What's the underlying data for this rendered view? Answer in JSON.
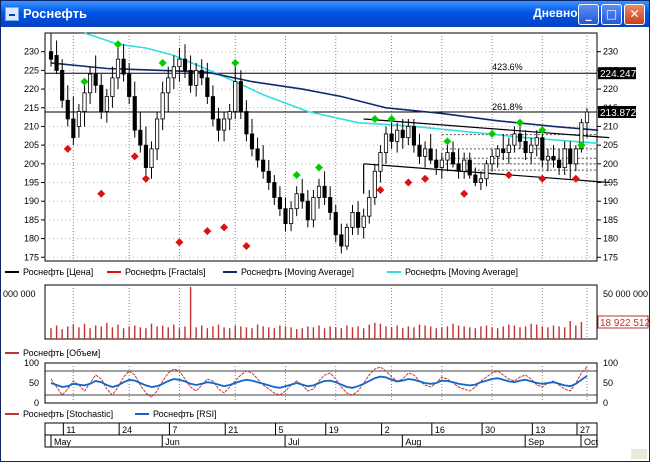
{
  "window": {
    "title": "Роснефть",
    "timeframe": "Дневной",
    "buttons": {
      "minimize": "_",
      "maximize": "□",
      "close": "✕"
    }
  },
  "colors": {
    "candle": "#000000",
    "fractal_up": "#00cc00",
    "fractal_down": "#dd1111",
    "ma_slow": "#102a6b",
    "ma_fast": "#33dddd",
    "volume": "#c23030",
    "stochastic": "#cc3333",
    "rsi": "#1166cc"
  },
  "chart_data": [
    {
      "type": "candlestick",
      "panel": "price",
      "ylim": [
        174,
        235
      ],
      "yticks": [
        175,
        180,
        185,
        190,
        195,
        200,
        205,
        210,
        215,
        220,
        225,
        230
      ],
      "price_labels": {
        "fib_level": "224.247",
        "last": "213.872"
      },
      "fib_annotations": [
        "423.6%",
        "261.8%"
      ],
      "legend": [
        "Роснефть [Цена]",
        "Роснефть [Fractals]",
        "Роснефть [Moving Average]",
        "Роснефть [Moving Average]"
      ],
      "candles": [
        {
          "o": 230,
          "h": 235,
          "l": 226,
          "c": 228
        },
        {
          "o": 229,
          "h": 233,
          "l": 224,
          "c": 225
        },
        {
          "o": 225,
          "h": 228,
          "l": 215,
          "c": 217
        },
        {
          "o": 217,
          "h": 221,
          "l": 210,
          "c": 212
        },
        {
          "o": 212,
          "h": 218,
          "l": 205,
          "c": 207
        },
        {
          "o": 210,
          "h": 216,
          "l": 207,
          "c": 214
        },
        {
          "o": 214,
          "h": 221,
          "l": 210,
          "c": 219
        },
        {
          "o": 219,
          "h": 226,
          "l": 216,
          "c": 224
        },
        {
          "o": 224,
          "h": 229,
          "l": 219,
          "c": 221
        },
        {
          "o": 221,
          "h": 224,
          "l": 212,
          "c": 214
        },
        {
          "o": 214,
          "h": 220,
          "l": 211,
          "c": 218
        },
        {
          "o": 218,
          "h": 226,
          "l": 215,
          "c": 223
        },
        {
          "o": 223,
          "h": 231,
          "l": 220,
          "c": 228
        },
        {
          "o": 228,
          "h": 232,
          "l": 222,
          "c": 224
        },
        {
          "o": 224,
          "h": 227,
          "l": 216,
          "c": 218
        },
        {
          "o": 218,
          "h": 222,
          "l": 207,
          "c": 209
        },
        {
          "o": 209,
          "h": 214,
          "l": 203,
          "c": 205
        },
        {
          "o": 205,
          "h": 210,
          "l": 197,
          "c": 199
        },
        {
          "o": 199,
          "h": 206,
          "l": 196,
          "c": 204
        },
        {
          "o": 204,
          "h": 214,
          "l": 201,
          "c": 212
        },
        {
          "o": 212,
          "h": 222,
          "l": 209,
          "c": 219
        },
        {
          "o": 219,
          "h": 226,
          "l": 214,
          "c": 223
        },
        {
          "o": 223,
          "h": 229,
          "l": 220,
          "c": 226
        },
        {
          "o": 226,
          "h": 231,
          "l": 222,
          "c": 228
        },
        {
          "o": 228,
          "h": 232,
          "l": 223,
          "c": 225
        },
        {
          "o": 225,
          "h": 229,
          "l": 219,
          "c": 221
        },
        {
          "o": 221,
          "h": 227,
          "l": 218,
          "c": 225
        },
        {
          "o": 225,
          "h": 228,
          "l": 221,
          "c": 223
        },
        {
          "o": 223,
          "h": 227,
          "l": 216,
          "c": 218
        },
        {
          "o": 218,
          "h": 221,
          "l": 210,
          "c": 212
        },
        {
          "o": 212,
          "h": 215,
          "l": 206,
          "c": 209
        },
        {
          "o": 209,
          "h": 214,
          "l": 206,
          "c": 212
        },
        {
          "o": 212,
          "h": 216,
          "l": 209,
          "c": 214
        },
        {
          "o": 214,
          "h": 226,
          "l": 212,
          "c": 222
        },
        {
          "o": 222,
          "h": 225,
          "l": 212,
          "c": 214
        },
        {
          "o": 214,
          "h": 217,
          "l": 206,
          "c": 208
        },
        {
          "o": 208,
          "h": 212,
          "l": 202,
          "c": 204
        },
        {
          "o": 204,
          "h": 207,
          "l": 199,
          "c": 201
        },
        {
          "o": 201,
          "h": 205,
          "l": 196,
          "c": 198
        },
        {
          "o": 198,
          "h": 201,
          "l": 193,
          "c": 195
        },
        {
          "o": 195,
          "h": 197,
          "l": 189,
          "c": 191
        },
        {
          "o": 191,
          "h": 194,
          "l": 186,
          "c": 188
        },
        {
          "o": 188,
          "h": 191,
          "l": 182,
          "c": 184
        },
        {
          "o": 184,
          "h": 190,
          "l": 182,
          "c": 188
        },
        {
          "o": 188,
          "h": 194,
          "l": 186,
          "c": 192
        },
        {
          "o": 192,
          "h": 196,
          "l": 188,
          "c": 190
        },
        {
          "o": 190,
          "h": 193,
          "l": 183,
          "c": 185
        },
        {
          "o": 185,
          "h": 193,
          "l": 183,
          "c": 191
        },
        {
          "o": 191,
          "h": 196,
          "l": 188,
          "c": 194
        },
        {
          "o": 194,
          "h": 198,
          "l": 189,
          "c": 191
        },
        {
          "o": 191,
          "h": 194,
          "l": 185,
          "c": 187
        },
        {
          "o": 187,
          "h": 189,
          "l": 179,
          "c": 181
        },
        {
          "o": 181,
          "h": 184,
          "l": 176,
          "c": 178
        },
        {
          "o": 178,
          "h": 184,
          "l": 177,
          "c": 183
        },
        {
          "o": 183,
          "h": 189,
          "l": 181,
          "c": 187
        },
        {
          "o": 187,
          "h": 190,
          "l": 181,
          "c": 183
        },
        {
          "o": 183,
          "h": 188,
          "l": 180,
          "c": 186
        },
        {
          "o": 186,
          "h": 193,
          "l": 184,
          "c": 191
        },
        {
          "o": 191,
          "h": 200,
          "l": 189,
          "c": 198
        },
        {
          "o": 198,
          "h": 205,
          "l": 195,
          "c": 203
        },
        {
          "o": 203,
          "h": 210,
          "l": 200,
          "c": 208
        },
        {
          "o": 208,
          "h": 212,
          "l": 204,
          "c": 206
        },
        {
          "o": 206,
          "h": 211,
          "l": 203,
          "c": 209
        },
        {
          "o": 209,
          "h": 212,
          "l": 204,
          "c": 207
        },
        {
          "o": 207,
          "h": 212,
          "l": 205,
          "c": 210
        },
        {
          "o": 210,
          "h": 212,
          "l": 203,
          "c": 205
        },
        {
          "o": 205,
          "h": 208,
          "l": 200,
          "c": 202
        },
        {
          "o": 202,
          "h": 206,
          "l": 199,
          "c": 204
        },
        {
          "o": 204,
          "h": 208,
          "l": 200,
          "c": 201
        },
        {
          "o": 201,
          "h": 204,
          "l": 197,
          "c": 199
        },
        {
          "o": 199,
          "h": 203,
          "l": 196,
          "c": 201
        },
        {
          "o": 201,
          "h": 205,
          "l": 198,
          "c": 203
        },
        {
          "o": 203,
          "h": 206,
          "l": 199,
          "c": 200
        },
        {
          "o": 200,
          "h": 204,
          "l": 196,
          "c": 198
        },
        {
          "o": 198,
          "h": 203,
          "l": 196,
          "c": 201
        },
        {
          "o": 201,
          "h": 203,
          "l": 196,
          "c": 197
        },
        {
          "o": 197,
          "h": 199,
          "l": 194,
          "c": 195
        },
        {
          "o": 195,
          "h": 198,
          "l": 193,
          "c": 196
        },
        {
          "o": 196,
          "h": 201,
          "l": 194,
          "c": 200
        },
        {
          "o": 200,
          "h": 204,
          "l": 198,
          "c": 202
        },
        {
          "o": 202,
          "h": 205,
          "l": 199,
          "c": 204
        },
        {
          "o": 204,
          "h": 208,
          "l": 201,
          "c": 203
        },
        {
          "o": 203,
          "h": 207,
          "l": 200,
          "c": 205
        },
        {
          "o": 205,
          "h": 210,
          "l": 203,
          "c": 208
        },
        {
          "o": 208,
          "h": 211,
          "l": 204,
          "c": 206
        },
        {
          "o": 206,
          "h": 209,
          "l": 201,
          "c": 203
        },
        {
          "o": 203,
          "h": 207,
          "l": 200,
          "c": 205
        },
        {
          "o": 205,
          "h": 209,
          "l": 202,
          "c": 207
        },
        {
          "o": 207,
          "h": 208,
          "l": 199,
          "c": 201
        },
        {
          "o": 201,
          "h": 204,
          "l": 198,
          "c": 202
        },
        {
          "o": 202,
          "h": 205,
          "l": 199,
          "c": 201
        },
        {
          "o": 201,
          "h": 204,
          "l": 197,
          "c": 199
        },
        {
          "o": 199,
          "h": 206,
          "l": 197,
          "c": 204
        },
        {
          "o": 204,
          "h": 206,
          "l": 196,
          "c": 200
        },
        {
          "o": 200,
          "h": 205,
          "l": 198,
          "c": 204
        },
        {
          "o": 204,
          "h": 212,
          "l": 203,
          "c": 211
        },
        {
          "o": 211,
          "h": 215,
          "l": 207,
          "c": 213.87
        }
      ],
      "fractals_up": [
        [
          6,
          222
        ],
        [
          12,
          232
        ],
        [
          20,
          227
        ],
        [
          33,
          227
        ],
        [
          44,
          197
        ],
        [
          48,
          199
        ],
        [
          58,
          212
        ],
        [
          61,
          212
        ],
        [
          71,
          206
        ],
        [
          79,
          208
        ],
        [
          84,
          211
        ],
        [
          88,
          209
        ],
        [
          95,
          205
        ]
      ],
      "fractals_down": [
        [
          3,
          204
        ],
        [
          9,
          192
        ],
        [
          15,
          202
        ],
        [
          17,
          196
        ],
        [
          23,
          179
        ],
        [
          28,
          182
        ],
        [
          31,
          183
        ],
        [
          35,
          178
        ],
        [
          59,
          193
        ],
        [
          64,
          195
        ],
        [
          67,
          196
        ],
        [
          74,
          192
        ],
        [
          82,
          197
        ],
        [
          88,
          196
        ],
        [
          94,
          196
        ]
      ],
      "ma_slow": [
        [
          0,
          227
        ],
        [
          10,
          225.5
        ],
        [
          20,
          225
        ],
        [
          28,
          224.5
        ],
        [
          36,
          222
        ],
        [
          45,
          220
        ],
        [
          52,
          218
        ],
        [
          60,
          215
        ],
        [
          70,
          213.5
        ],
        [
          80,
          211.5
        ],
        [
          90,
          210
        ],
        [
          98,
          209
        ]
      ],
      "ma_fast": [
        [
          6,
          235
        ],
        [
          12,
          232
        ],
        [
          17,
          231
        ],
        [
          22,
          229
        ],
        [
          30,
          224
        ],
        [
          38,
          218.5
        ],
        [
          46,
          214
        ],
        [
          55,
          211
        ],
        [
          65,
          210
        ],
        [
          75,
          208.5
        ],
        [
          85,
          207
        ],
        [
          98,
          205.5
        ]
      ],
      "trendlines": [
        [
          [
            56,
            212
          ],
          [
            100,
            207
          ]
        ],
        [
          [
            56,
            200
          ],
          [
            100,
            195
          ]
        ]
      ],
      "fib_levels": [
        224.247,
        213.87
      ],
      "fib_small_levels": [
        207.8,
        204,
        201.5,
        200,
        198.3
      ]
    },
    {
      "type": "bar",
      "panel": "volume",
      "legend": [
        "Роснефть [Объем]"
      ],
      "axis_labels": [
        "50 000 000",
        "000 000"
      ],
      "last_label": "18 922 512",
      "ylim": [
        0,
        60000000
      ],
      "values": [
        12,
        15,
        11,
        14,
        16,
        13,
        17,
        12,
        15,
        14,
        18,
        13,
        16,
        12,
        14,
        15,
        13,
        12,
        17,
        14,
        15,
        13,
        16,
        12,
        14,
        58,
        13,
        15,
        12,
        14,
        16,
        13,
        12,
        15,
        14,
        13,
        12,
        16,
        14,
        13,
        12,
        15,
        14,
        13,
        11,
        12,
        14,
        13,
        15,
        12,
        14,
        13,
        12,
        15,
        13,
        14,
        12,
        16,
        18,
        17,
        14,
        13,
        15,
        12,
        14,
        13,
        16,
        15,
        14,
        12,
        13,
        14,
        17,
        15,
        14,
        13,
        12,
        14,
        15,
        13,
        12,
        14,
        16,
        15,
        13,
        14,
        17,
        16,
        14,
        13,
        15,
        14,
        13,
        20,
        15,
        18.9
      ]
    },
    {
      "type": "line",
      "panel": "oscillator",
      "legend": [
        "Роснефть [Stochastic]",
        "Роснефть [RSI]"
      ],
      "ylim": [
        0,
        100
      ],
      "yticks": [
        0,
        50,
        100
      ],
      "series": [
        {
          "name": "Роснефть [Stochastic]",
          "values": [
            60,
            40,
            20,
            35,
            55,
            45,
            30,
            50,
            70,
            60,
            35,
            20,
            40,
            65,
            80,
            70,
            45,
            25,
            15,
            30,
            55,
            75,
            85,
            80,
            60,
            40,
            30,
            45,
            60,
            55,
            35,
            25,
            40,
            55,
            70,
            80,
            75,
            60,
            45,
            35,
            25,
            20,
            30,
            45,
            55,
            45,
            30,
            35,
            55,
            70,
            75,
            60,
            40,
            25,
            20,
            30,
            50,
            70,
            85,
            90,
            80,
            65,
            55,
            60,
            75,
            70,
            55,
            45,
            40,
            50,
            65,
            60,
            50,
            40,
            35,
            30,
            40,
            55,
            65,
            75,
            80,
            70,
            60,
            55,
            65,
            70,
            60,
            45,
            40,
            50,
            55,
            45,
            35,
            30,
            50,
            75,
            90
          ]
        },
        {
          "name": "Роснефть [RSI]",
          "values": [
            50,
            45,
            40,
            42,
            48,
            46,
            44,
            48,
            55,
            52,
            45,
            40,
            44,
            52,
            58,
            56,
            50,
            44,
            40,
            42,
            48,
            55,
            60,
            58,
            54,
            48,
            45,
            48,
            52,
            50,
            46,
            42,
            45,
            50,
            55,
            58,
            56,
            52,
            48,
            44,
            40,
            38,
            42,
            46,
            50,
            46,
            42,
            44,
            50,
            55,
            56,
            52,
            46,
            40,
            38,
            42,
            48,
            55,
            62,
            66,
            64,
            58,
            54,
            56,
            60,
            58,
            54,
            50,
            48,
            50,
            56,
            55,
            52,
            48,
            46,
            44,
            46,
            52,
            56,
            60,
            62,
            58,
            54,
            52,
            56,
            58,
            54,
            50,
            48,
            50,
            52,
            48,
            44,
            42,
            48,
            58,
            68
          ]
        }
      ]
    }
  ],
  "date_axis": {
    "days": [
      "11",
      "24",
      "7",
      "21",
      "5",
      "19",
      "2",
      "16",
      "30",
      "13",
      "27"
    ],
    "months": [
      "May",
      "Jun",
      "Jul",
      "Aug",
      "Sep",
      "Oct"
    ]
  }
}
